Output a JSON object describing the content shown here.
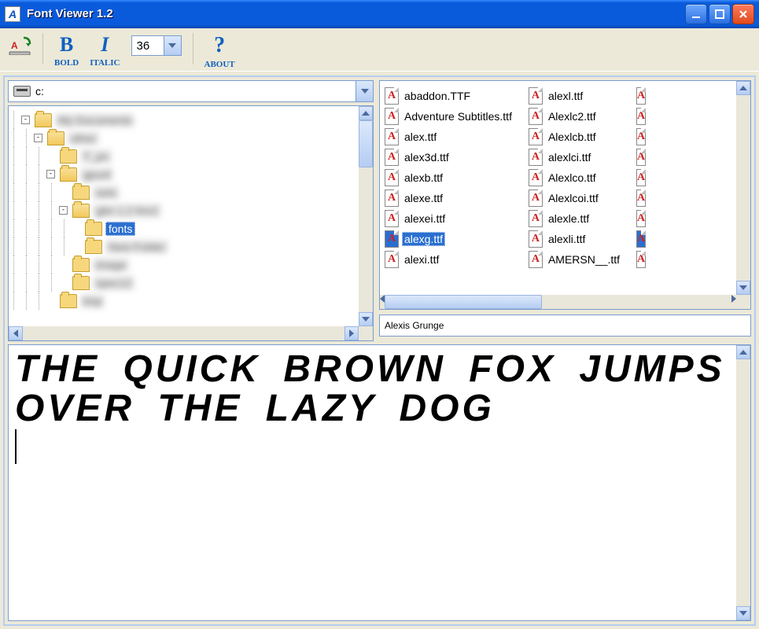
{
  "window": {
    "title": "Font Viewer 1.2"
  },
  "toolbar": {
    "bold_label": "BOLD",
    "italic_label": "ITALIC",
    "about_label": "ABOUT",
    "font_size": "36"
  },
  "drive": {
    "label": "c:"
  },
  "tree": {
    "items": [
      {
        "indent": 1,
        "toggle": "-",
        "open": true,
        "blurred": true,
        "label": "My Documents"
      },
      {
        "indent": 2,
        "toggle": "-",
        "open": true,
        "blurred": true,
        "label": "other"
      },
      {
        "indent": 3,
        "toggle": "",
        "open": false,
        "blurred": true,
        "label": "T_pn"
      },
      {
        "indent": 3,
        "toggle": "-",
        "open": true,
        "blurred": true,
        "label": "gpuril"
      },
      {
        "indent": 4,
        "toggle": "",
        "open": false,
        "blurred": true,
        "label": "sets"
      },
      {
        "indent": 4,
        "toggle": "-",
        "open": true,
        "blurred": true,
        "label": "gbn 1.2 fmr2"
      },
      {
        "indent": 5,
        "toggle": "",
        "open": false,
        "blurred": false,
        "selected": true,
        "label": "fonts"
      },
      {
        "indent": 5,
        "toggle": "",
        "open": false,
        "blurred": true,
        "label": "New Folder"
      },
      {
        "indent": 4,
        "toggle": "",
        "open": false,
        "blurred": true,
        "label": "image"
      },
      {
        "indent": 4,
        "toggle": "",
        "open": false,
        "blurred": true,
        "label": "spec12"
      },
      {
        "indent": 3,
        "toggle": "",
        "open": false,
        "blurred": true,
        "label": "tmp"
      }
    ]
  },
  "files": {
    "col1": [
      {
        "name": "abaddon.TTF"
      },
      {
        "name": "Adventure Subtitles.ttf"
      },
      {
        "name": "alex.ttf"
      },
      {
        "name": "alex3d.ttf"
      },
      {
        "name": "alexb.ttf"
      },
      {
        "name": "alexe.ttf"
      },
      {
        "name": "alexei.ttf"
      },
      {
        "name": "alexg.ttf",
        "selected": true
      },
      {
        "name": "alexi.ttf"
      }
    ],
    "col2": [
      {
        "name": "alexl.ttf"
      },
      {
        "name": "Alexlc2.ttf"
      },
      {
        "name": "Alexlcb.ttf"
      },
      {
        "name": "alexlci.ttf"
      },
      {
        "name": "Alexlco.ttf"
      },
      {
        "name": "Alexlcoi.ttf"
      },
      {
        "name": "alexle.ttf"
      },
      {
        "name": "alexli.ttf"
      },
      {
        "name": "AMERSN__.ttf"
      }
    ]
  },
  "font_name": "Alexis Grunge",
  "preview": {
    "text": "THE QUICK BROWN FOX JUMPS OVER THE LAZY DOG"
  }
}
